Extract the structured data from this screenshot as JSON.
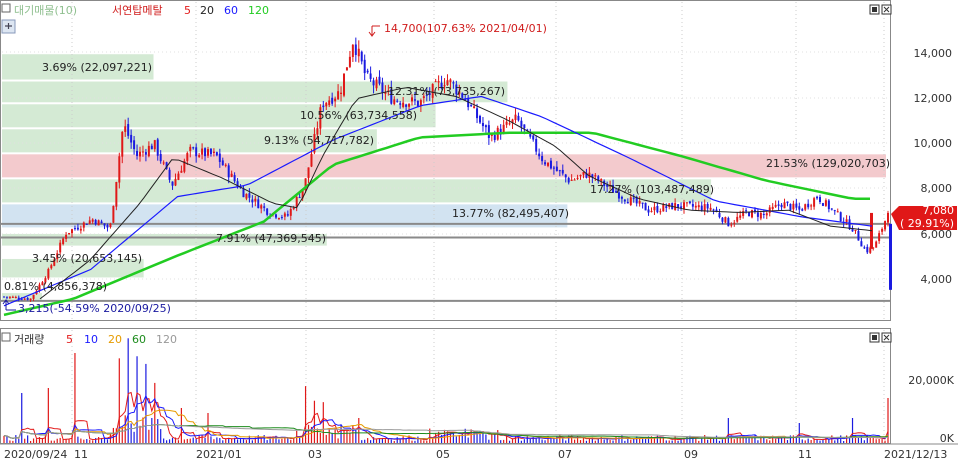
{
  "legend_price": {
    "name": "대기매물(10)",
    "ma_title": "서연탑메탈",
    "ma": [
      {
        "label": "5",
        "color": "#e31b1b"
      },
      {
        "label": "20",
        "color": "#222222"
      },
      {
        "label": "60",
        "color": "#1a1aff"
      },
      {
        "label": "120",
        "color": "#22cc22"
      }
    ]
  },
  "legend_volume": {
    "name": "거래량",
    "ma": [
      {
        "label": "5",
        "color": "#e31b1b"
      },
      {
        "label": "10",
        "color": "#1a1aff"
      },
      {
        "label": "20",
        "color": "#e69b00"
      },
      {
        "label": "60",
        "color": "#1d8c1d"
      },
      {
        "label": "120",
        "color": "#999999"
      }
    ]
  },
  "price_axis": {
    "ticks": [
      "14,000",
      "12,000",
      "10,000",
      "8,000",
      "6,000",
      "4,000"
    ]
  },
  "volume_axis": {
    "ticks": [
      "20,000K",
      "0K"
    ]
  },
  "date_axis": {
    "labels": [
      "2020/09/24",
      "11",
      "2021/01",
      "03",
      "05",
      "07",
      "09",
      "11",
      "2021/12/13"
    ]
  },
  "annotations": {
    "high": "14,700(107.63% 2021/04/01)",
    "low": "3,215(-54.59% 2020/09/25)",
    "current_price": "7,080",
    "current_change": "( 29.91%)"
  },
  "chart_data": {
    "type": "candlestick",
    "overlay": "volume profile (대기매물) - 10 price bands",
    "price_range": [
      3215,
      14700
    ],
    "volume_profile": [
      {
        "low": 3215,
        "high": 3600,
        "label": "0.81% (4,856,378)",
        "pct": 0.81
      },
      {
        "low": 4200,
        "high": 5100,
        "label": "3.45% (20,653,145)",
        "pct": 3.45
      },
      {
        "low": 5600,
        "high": 6200,
        "label": "7.91% (47,369,545)",
        "pct": 7.91
      },
      {
        "low": 6400,
        "high": 7500,
        "label": "13.77% (82,495,407)",
        "pct": 13.77
      },
      {
        "low": 7500,
        "high": 8600,
        "label": "17.27% (103,487,489)",
        "pct": 17.27
      },
      {
        "low": 8600,
        "high": 9700,
        "label": "21.53% (129,020,703)",
        "pct": 21.53
      },
      {
        "low": 9700,
        "high": 10800,
        "label": "9.13% (54,717,782)",
        "pct": 9.13
      },
      {
        "low": 10800,
        "high": 11900,
        "label": "10.56% (63,734,558)",
        "pct": 10.56
      },
      {
        "low": 11900,
        "high": 12900,
        "label": "12.31% (73,735,267)",
        "pct": 12.31
      },
      {
        "low": 12900,
        "high": 14100,
        "label": "3.69% (22,097,221)",
        "pct": 3.69
      }
    ],
    "levels": [
      3215,
      6000,
      6600
    ],
    "last_price": 7080,
    "last_change_pct": 29.91,
    "ma120_key": [
      [
        0,
        2600
      ],
      [
        0.08,
        3300
      ],
      [
        0.2,
        5200
      ],
      [
        0.3,
        6700
      ],
      [
        0.38,
        9200
      ],
      [
        0.48,
        10400
      ],
      [
        0.58,
        10600
      ],
      [
        0.68,
        10600
      ],
      [
        0.78,
        9600
      ],
      [
        0.88,
        8500
      ],
      [
        0.98,
        7700
      ]
    ],
    "ma60_key": [
      [
        0,
        3000
      ],
      [
        0.1,
        4600
      ],
      [
        0.2,
        7800
      ],
      [
        0.28,
        8300
      ],
      [
        0.38,
        10300
      ],
      [
        0.48,
        11800
      ],
      [
        0.55,
        12200
      ],
      [
        0.62,
        11300
      ],
      [
        0.72,
        9500
      ],
      [
        0.82,
        7600
      ],
      [
        0.92,
        6900
      ],
      [
        1.0,
        6500
      ]
    ],
    "ma20_key": [
      [
        0,
        3300
      ],
      [
        0.06,
        5000
      ],
      [
        0.12,
        7500
      ],
      [
        0.16,
        9500
      ],
      [
        0.22,
        8600
      ],
      [
        0.28,
        7500
      ],
      [
        0.31,
        7300
      ],
      [
        0.34,
        9600
      ],
      [
        0.38,
        12100
      ],
      [
        0.44,
        12600
      ],
      [
        0.5,
        12200
      ],
      [
        0.56,
        11200
      ],
      [
        0.62,
        10000
      ],
      [
        0.66,
        8700
      ],
      [
        0.72,
        7700
      ],
      [
        0.78,
        7200
      ],
      [
        0.84,
        7100
      ],
      [
        0.9,
        7200
      ],
      [
        0.95,
        6500
      ],
      [
        1.0,
        6300
      ]
    ],
    "price_key": [
      [
        0,
        3400
      ],
      [
        0.03,
        3300
      ],
      [
        0.05,
        4500
      ],
      [
        0.07,
        6200
      ],
      [
        0.1,
        6800
      ],
      [
        0.12,
        6400
      ],
      [
        0.135,
        11000
      ],
      [
        0.15,
        9600
      ],
      [
        0.17,
        10100
      ],
      [
        0.19,
        8300
      ],
      [
        0.21,
        9800
      ],
      [
        0.24,
        9600
      ],
      [
        0.27,
        8000
      ],
      [
        0.3,
        7100
      ],
      [
        0.32,
        6900
      ],
      [
        0.34,
        8300
      ],
      [
        0.36,
        11900
      ],
      [
        0.38,
        12400
      ],
      [
        0.395,
        14700
      ],
      [
        0.41,
        13000
      ],
      [
        0.44,
        12100
      ],
      [
        0.47,
        11900
      ],
      [
        0.5,
        13000
      ],
      [
        0.52,
        12200
      ],
      [
        0.55,
        10400
      ],
      [
        0.58,
        11200
      ],
      [
        0.61,
        9400
      ],
      [
        0.64,
        8500
      ],
      [
        0.66,
        8800
      ],
      [
        0.7,
        7800
      ],
      [
        0.73,
        7200
      ],
      [
        0.76,
        7400
      ],
      [
        0.8,
        7300
      ],
      [
        0.82,
        6600
      ],
      [
        0.84,
        7100
      ],
      [
        0.86,
        7000
      ],
      [
        0.88,
        7500
      ],
      [
        0.9,
        7200
      ],
      [
        0.92,
        7800
      ],
      [
        0.94,
        7100
      ],
      [
        0.96,
        6400
      ],
      [
        0.975,
        5400
      ],
      [
        0.985,
        5600
      ],
      [
        1.0,
        7080
      ]
    ]
  }
}
